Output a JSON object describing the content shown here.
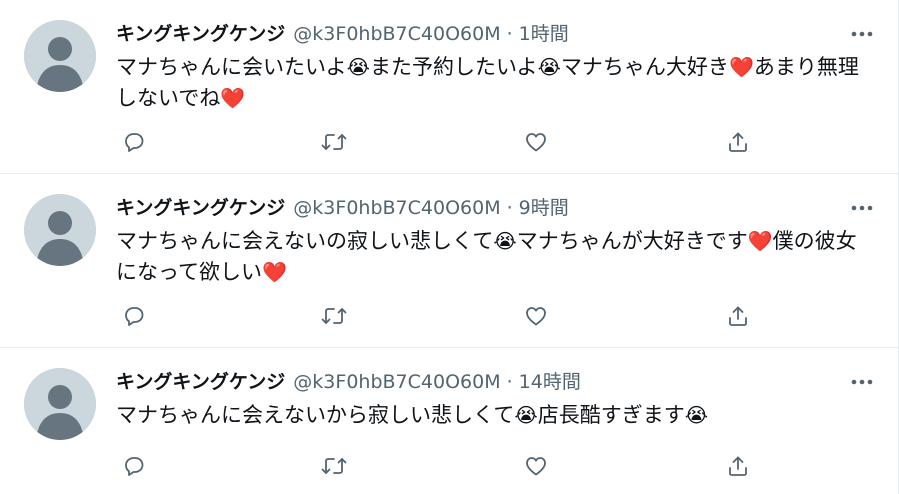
{
  "colors": {
    "secondary": "#536471",
    "heart": "#e0245e",
    "divider": "#e6ecf0"
  },
  "tweets": [
    {
      "name": "キングキングケンジ",
      "handle": "@k3F0hbB7C40O60M",
      "separator": "·",
      "time": "1時間",
      "text_parts": [
        {
          "type": "text",
          "value": "マナちゃんに会いたいよ"
        },
        {
          "type": "emoji",
          "value": "😭",
          "icon": "loudly-crying-face-emoji"
        },
        {
          "type": "text",
          "value": "また予約したいよ"
        },
        {
          "type": "emoji",
          "value": "😭",
          "icon": "loudly-crying-face-emoji"
        },
        {
          "type": "text",
          "value": "マナちゃん大好き"
        },
        {
          "type": "emoji",
          "value": "❤️",
          "icon": "red-heart-emoji"
        },
        {
          "type": "text",
          "value": "あまり無理しないでね"
        },
        {
          "type": "emoji",
          "value": "❤️",
          "icon": "red-heart-emoji"
        }
      ]
    },
    {
      "name": "キングキングケンジ",
      "handle": "@k3F0hbB7C40O60M",
      "separator": "·",
      "time": "9時間",
      "text_parts": [
        {
          "type": "text",
          "value": "マナちゃんに会えないの寂しい悲しくて"
        },
        {
          "type": "emoji",
          "value": "😭",
          "icon": "loudly-crying-face-emoji"
        },
        {
          "type": "text",
          "value": "マナちゃんが大好きです"
        },
        {
          "type": "emoji",
          "value": "❤️",
          "icon": "red-heart-emoji"
        },
        {
          "type": "text",
          "value": "僕の彼女になって欲しい"
        },
        {
          "type": "emoji",
          "value": "❤️",
          "icon": "red-heart-emoji"
        }
      ]
    },
    {
      "name": "キングキングケンジ",
      "handle": "@k3F0hbB7C40O60M",
      "separator": "·",
      "time": "14時間",
      "text_parts": [
        {
          "type": "text",
          "value": "マナちゃんに会えないから寂しい悲しくて"
        },
        {
          "type": "emoji",
          "value": "😭",
          "icon": "loudly-crying-face-emoji"
        },
        {
          "type": "text",
          "value": "店長酷すぎます"
        },
        {
          "type": "emoji",
          "value": "😭",
          "icon": "loudly-crying-face-emoji"
        }
      ]
    }
  ],
  "action_icons": [
    "reply-icon",
    "retweet-icon",
    "like-icon",
    "share-icon"
  ],
  "more_icon": "more-options-icon",
  "avatar_icon": "default-avatar-icon"
}
